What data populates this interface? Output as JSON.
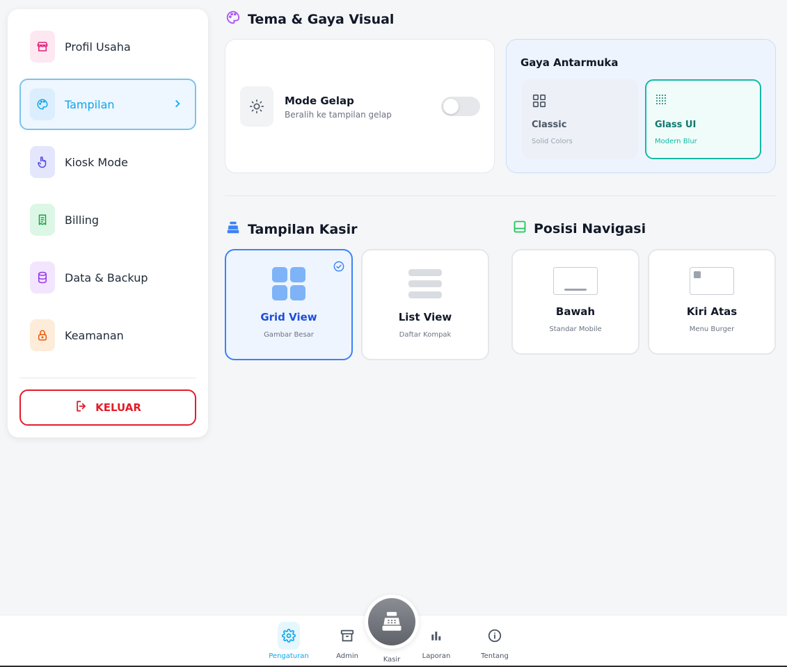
{
  "sidebar": {
    "items": [
      {
        "label": "Profil Usaha",
        "icon": "store-icon",
        "color": "#e11d74",
        "bg": "#fde7f1"
      },
      {
        "label": "Tampilan",
        "icon": "palette-icon",
        "color": "#0ea5e9",
        "bg": "#dbeefe"
      },
      {
        "label": "Kiosk Mode",
        "icon": "pointer-icon",
        "color": "#4f46e5",
        "bg": "#e4e6fd"
      },
      {
        "label": "Billing",
        "icon": "receipt-icon",
        "color": "#16a34a",
        "bg": "#dcf7e5"
      },
      {
        "label": "Data & Backup",
        "icon": "database-icon",
        "color": "#9333ea",
        "bg": "#f3e5fd"
      },
      {
        "label": "Keamanan",
        "icon": "lock-icon",
        "color": "#ea580c",
        "bg": "#fdecd9"
      }
    ],
    "logout_label": "KELUAR"
  },
  "theme": {
    "title": "Tema & Gaya Visual",
    "dark_mode": {
      "title": "Mode Gelap",
      "subtitle": "Beralih ke tampilan gelap",
      "enabled": false
    },
    "interface": {
      "title": "Gaya Antarmuka",
      "options": [
        {
          "title": "Classic",
          "subtitle": "Solid Colors",
          "selected": false
        },
        {
          "title": "Glass UI",
          "subtitle": "Modern Blur",
          "selected": true
        }
      ]
    }
  },
  "cashier": {
    "title": "Tampilan Kasir",
    "options": [
      {
        "title": "Grid View",
        "subtitle": "Gambar Besar",
        "selected": true
      },
      {
        "title": "List View",
        "subtitle": "Daftar Kompak",
        "selected": false
      }
    ]
  },
  "navigation": {
    "title": "Posisi Navigasi",
    "options": [
      {
        "title": "Bawah",
        "subtitle": "Standar Mobile"
      },
      {
        "title": "Kiri Atas",
        "subtitle": "Menu Burger"
      }
    ]
  },
  "bottom_nav": {
    "items": [
      {
        "label": "Pengaturan",
        "icon": "gear-icon",
        "active": true
      },
      {
        "label": "Admin",
        "icon": "archive-icon",
        "active": false
      },
      {
        "label": "Kasir",
        "icon": "cash-register-icon",
        "active": false
      },
      {
        "label": "Laporan",
        "icon": "bar-chart-icon",
        "active": false
      },
      {
        "label": "Tentang",
        "icon": "info-icon",
        "active": false
      }
    ]
  },
  "colors": {
    "accent": "#0ea5e9",
    "danger": "#e11d2a",
    "selected_blue": "#3b82f6",
    "teal": "#14b8a6"
  }
}
